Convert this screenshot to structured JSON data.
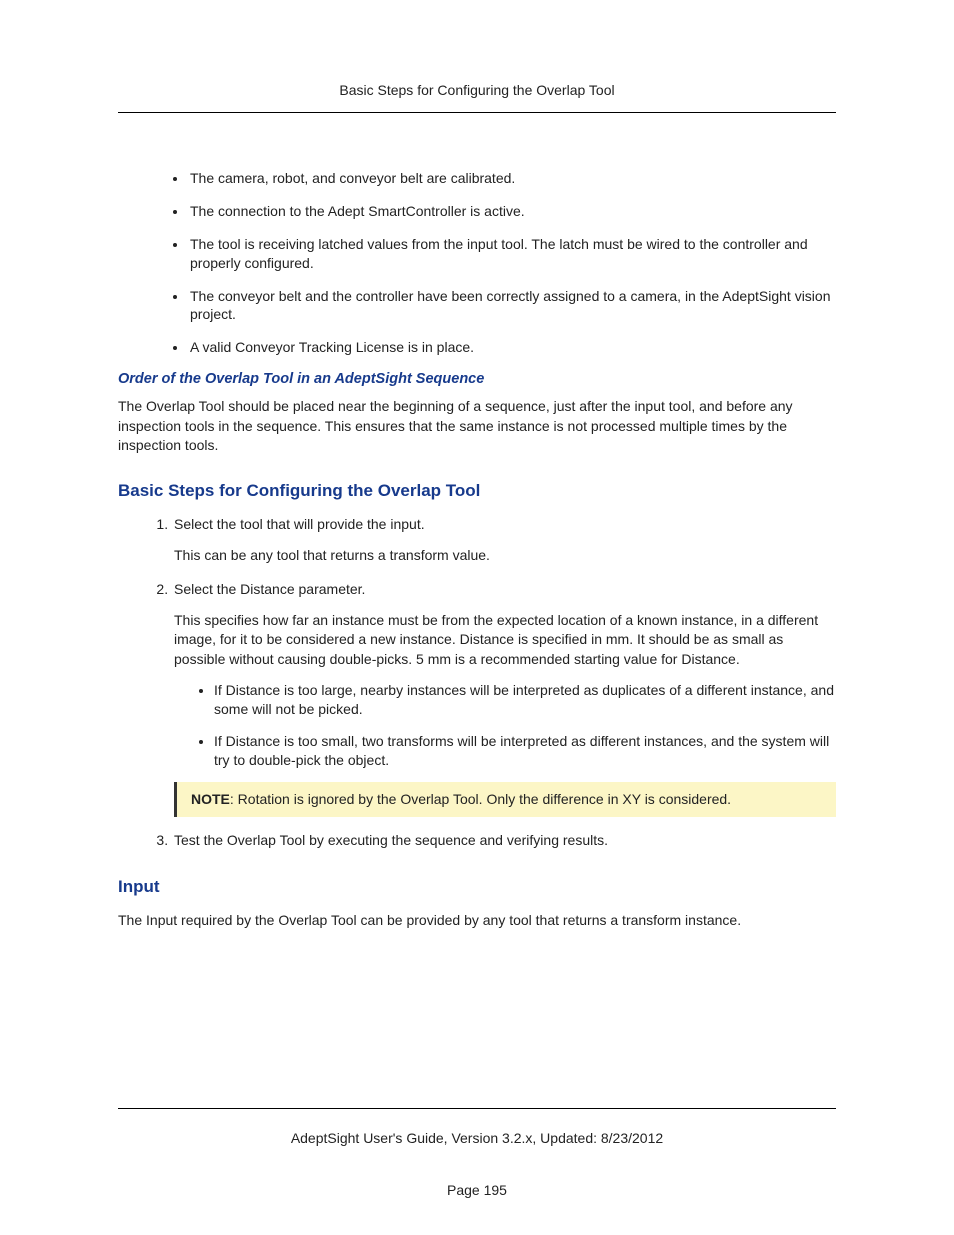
{
  "header": {
    "title": "Basic Steps for Configuring the Overlap Tool"
  },
  "prelist": [
    "The camera, robot, and conveyor belt are calibrated.",
    "The connection to the Adept SmartController is active.",
    "The tool is receiving latched values from the input tool. The latch must be wired to the controller and properly configured.",
    "The conveyor belt and the controller have been correctly assigned to a camera, in the AdeptSight vision project.",
    "A valid Conveyor Tracking License is in place."
  ],
  "subhead": "Order of the Overlap Tool in an AdeptSight Sequence",
  "subhead_para": "The Overlap Tool should be placed near the beginning of a sequence, just after the input tool, and before any inspection tools in the sequence. This ensures that the same instance is not processed multiple times by the inspection tools.",
  "h2_basic": "Basic Steps for Configuring the Overlap Tool",
  "steps": {
    "s1": {
      "title": "Select the tool that will provide the input.",
      "detail": "This can be any tool that returns a transform value."
    },
    "s2": {
      "title": "Select the Distance parameter.",
      "detail": "This specifies how far an instance must be from the expected location of a known instance, in a different image, for it to be considered a new instance. Distance is specified in mm. It should be as small as possible without causing double-picks. 5 mm is a recommended starting value for Distance.",
      "subs": [
        "If Distance is too large, nearby instances will be interpreted as duplicates of a different instance, and some will not be picked.",
        "If Distance is too small, two transforms will be interpreted as different instances, and the system will try to double-pick the object."
      ],
      "note_label": "NOTE",
      "note_text": ": Rotation is ignored by the Overlap Tool. Only the difference in XY is considered."
    },
    "s3": {
      "title": "Test the Overlap Tool by executing the sequence and verifying results."
    }
  },
  "h2_input": "Input",
  "input_para": "The Input required by the Overlap Tool can be provided by any tool that returns a transform instance.",
  "footer": "AdeptSight User's Guide,  Version 3.2.x, Updated: 8/23/2012",
  "pagenum": "Page 195"
}
